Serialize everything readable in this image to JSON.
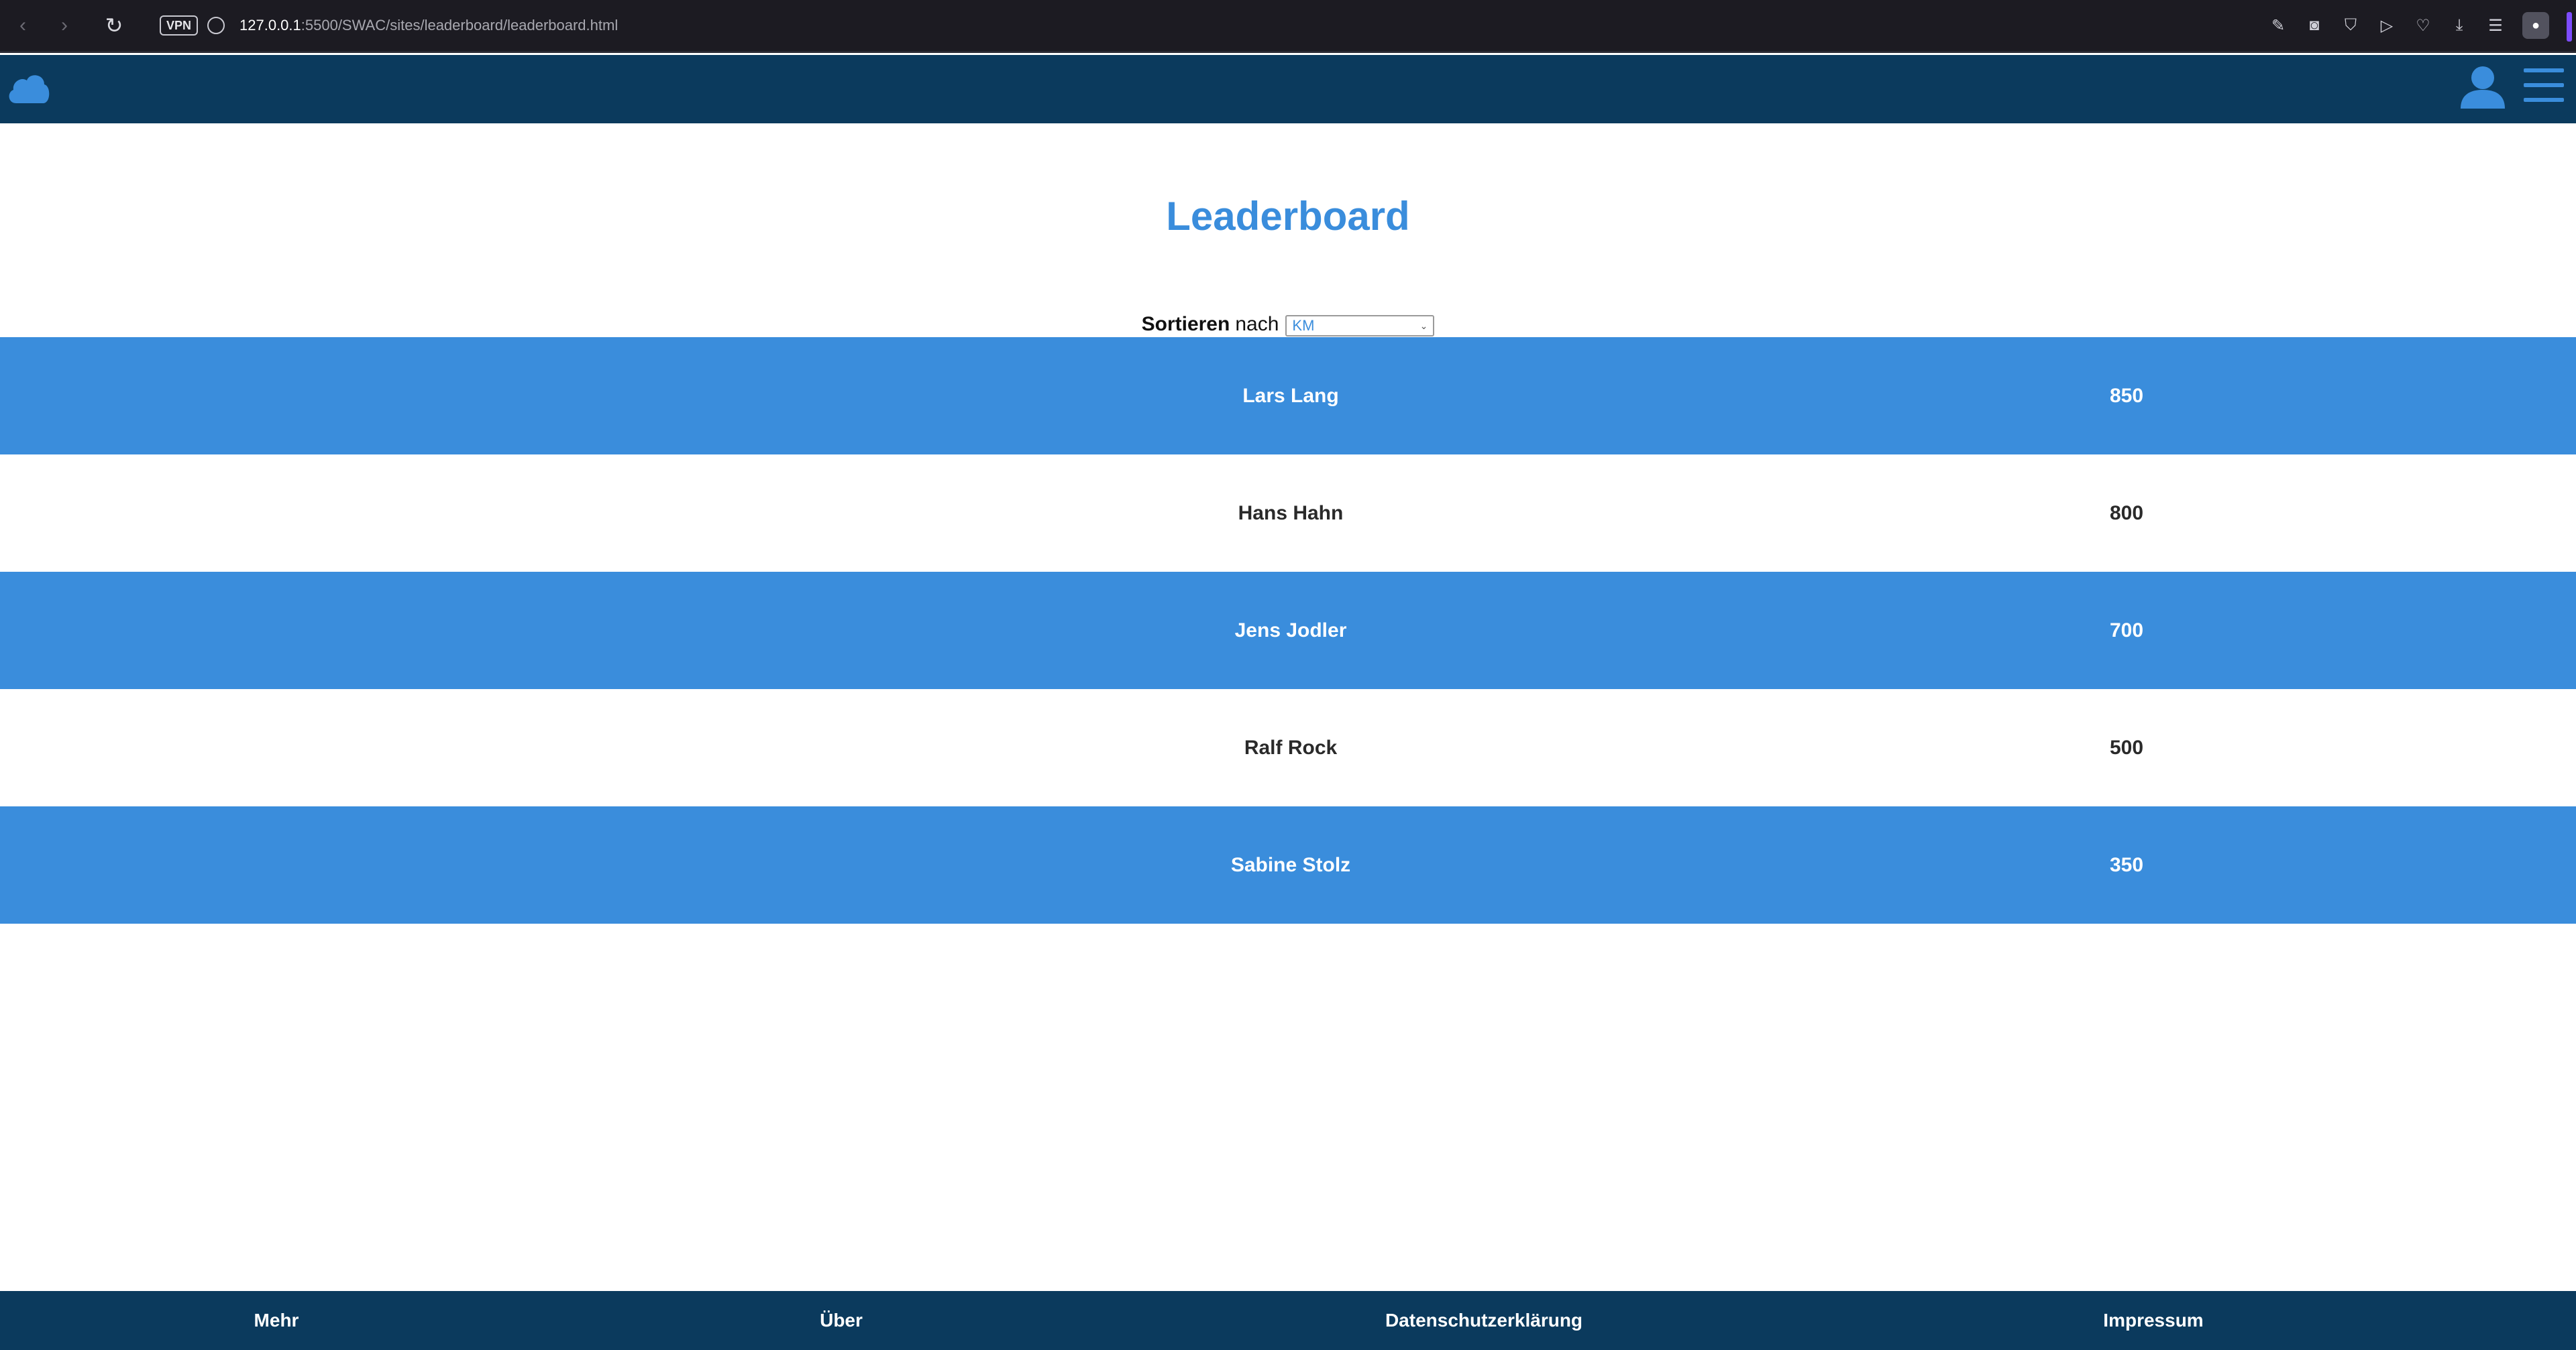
{
  "browser": {
    "url_host": "127.0.0.1",
    "url_rest": ":5500/SWAC/sites/leaderboard/leaderboard.html",
    "vpn_label": "VPN"
  },
  "colors": {
    "header_bg": "#0b3a5d",
    "accent_blue": "#3a8ddc"
  },
  "header": {
    "logo_icon": "cloud-icon",
    "user_icon": "user-icon",
    "menu_icon": "hamburger-menu-icon"
  },
  "main": {
    "title": "Leaderboard",
    "sort": {
      "label_bold": "Sortieren",
      "label_rest": "nach",
      "selected": "KM"
    },
    "rows": [
      {
        "name": "Lars Lang",
        "score": "850"
      },
      {
        "name": "Hans Hahn",
        "score": "800"
      },
      {
        "name": "Jens Jodler",
        "score": "700"
      },
      {
        "name": "Ralf Rock",
        "score": "500"
      },
      {
        "name": "Sabine Stolz",
        "score": "350"
      }
    ]
  },
  "footer": {
    "links": [
      "Mehr",
      "Über",
      "Datenschutzerklärung",
      "Impressum"
    ]
  }
}
